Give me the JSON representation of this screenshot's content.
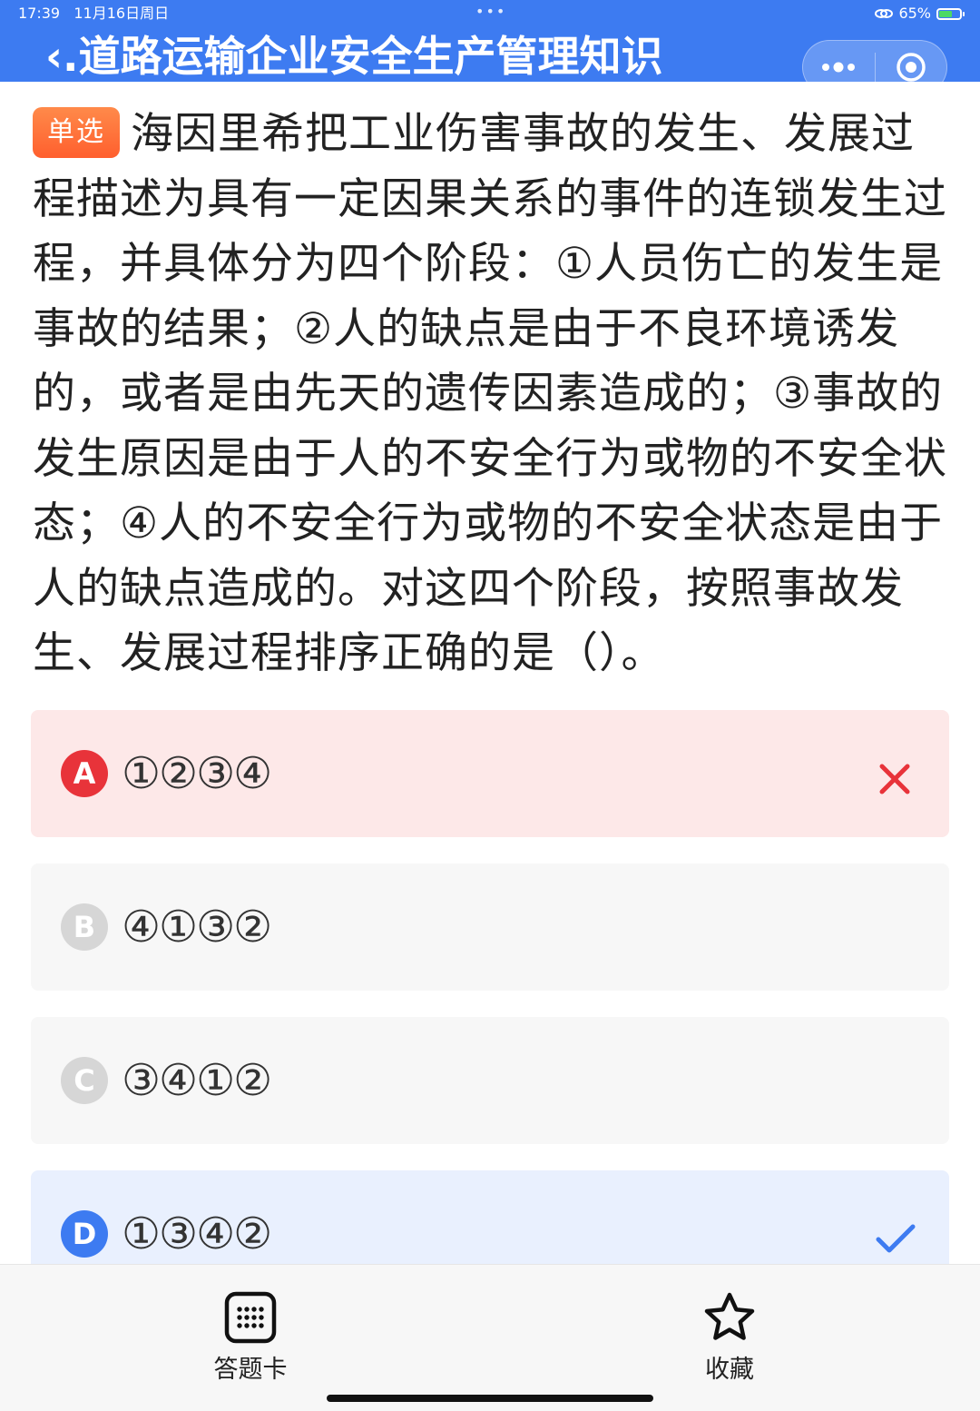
{
  "status_bar": {
    "time": "17:39",
    "date": "11月16日周日",
    "dots": "•••",
    "battery": "65%",
    "battery_level": 0.65
  },
  "header": {
    "title": "\u0003.道路运输企业安全生产管理知识",
    "capsule_icons": [
      "more-icon",
      "target-icon"
    ]
  },
  "question": {
    "tag": "单选",
    "text": "海因里希把工业伤害事故的发生、发展过程描述为具有一定因果关系的事件的连锁发生过程，并具体分为四个阶段：①人员伤亡的发生是事故的结果；②人的缺点是由于不良环境诱发的，或者是由先天的遗传因素造成的；③事故的发生原因是由于人的不安全行为或物的不安全状态；④人的不安全行为或物的不安全状态是由于人的缺点造成的。对这四个阶段，按照事故发生、发展过程排序正确的是（）。"
  },
  "options": [
    {
      "letter": "A",
      "text": "①②③④",
      "state": "wrong"
    },
    {
      "letter": "B",
      "text": "④①③②",
      "state": "normal"
    },
    {
      "letter": "C",
      "text": "③④①②",
      "state": "normal"
    },
    {
      "letter": "D",
      "text": "①③④②",
      "state": "correct"
    }
  ],
  "colors": {
    "header": "#3d7bf1",
    "wrong": "#e8333a",
    "correct": "#3d7bf1",
    "tag": "#ff6a35"
  },
  "bottom_bar": {
    "answer_card_label": "答题卡",
    "favorite_label": "收藏",
    "answer_card_icon": "grid-icon",
    "favorite_icon": "star-icon"
  }
}
